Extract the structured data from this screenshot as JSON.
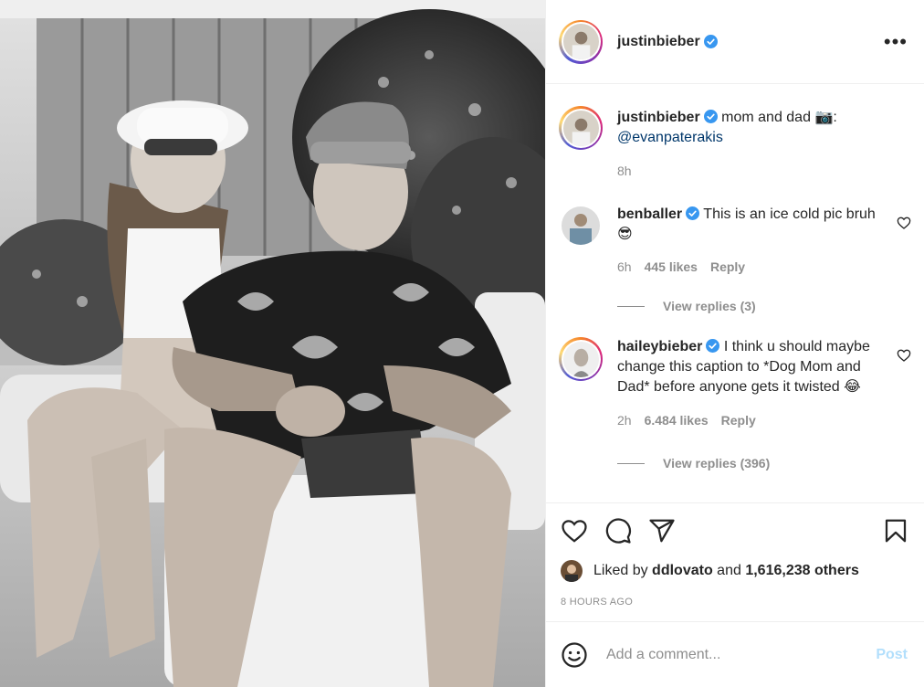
{
  "header": {
    "username": "justinbieber",
    "verified": true,
    "more_label": "•••"
  },
  "caption": {
    "username": "justinbieber",
    "text": "mom and dad",
    "camera_emoji": "📷",
    "colon": ":",
    "mention": "@evanpaterakis",
    "time": "8h"
  },
  "comments": [
    {
      "username": "benballer",
      "text": "This is an ice cold pic bruh",
      "emoji": "😎",
      "time": "6h",
      "likes": "445 likes",
      "reply_label": "Reply",
      "view_replies": "View replies (3)"
    },
    {
      "username": "haileybieber",
      "text": "I think u should maybe change this caption to *Dog Mom and Dad* before anyone gets it twisted",
      "emoji": "😂",
      "time": "2h",
      "likes": "6.484 likes",
      "reply_label": "Reply",
      "view_replies": "View replies (396)"
    }
  ],
  "likes": {
    "prefix": "Liked by",
    "first_liker": "ddlovato",
    "and": "and",
    "others": "1,616,238 others"
  },
  "time_ago": "8 HOURS AGO",
  "composer": {
    "placeholder": "Add a comment...",
    "post_label": "Post"
  },
  "colors": {
    "verified": "#3897f0",
    "post_disabled": "#b2dffc",
    "secondary_text": "#8e8e8e",
    "mention": "#00376b"
  },
  "icons": [
    "heart-icon",
    "comment-icon",
    "share-icon",
    "bookmark-icon",
    "emoji-icon",
    "more-icon",
    "verified-icon"
  ]
}
